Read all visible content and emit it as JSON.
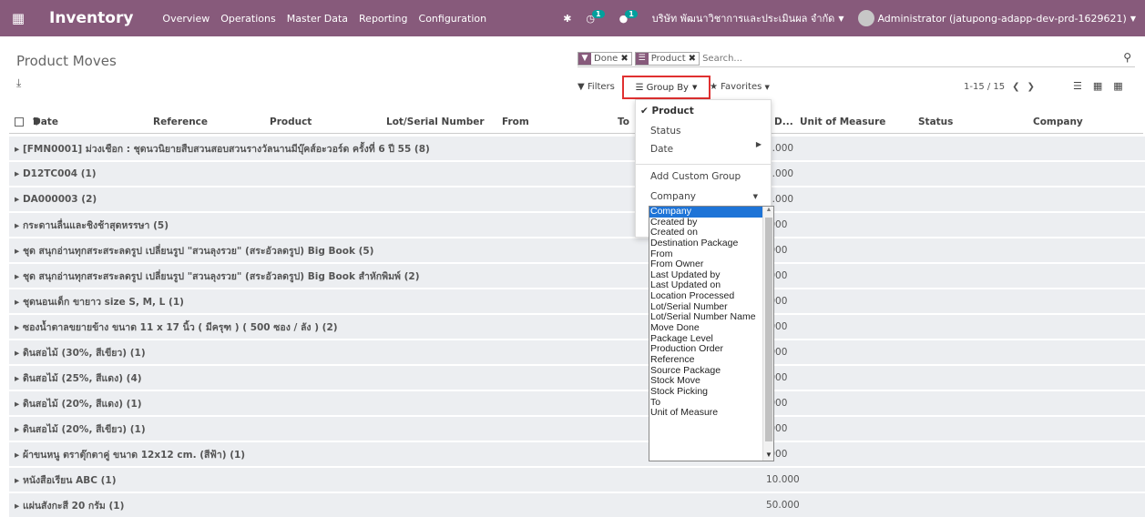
{
  "navbar": {
    "app_name": "Inventory",
    "menu": [
      "Overview",
      "Operations",
      "Master Data",
      "Reporting",
      "Configuration"
    ],
    "activity_badge": "1",
    "messaging_badge": "1",
    "company": "บริษัท พัฒนาวิชาการและประเมินผล จำกัด",
    "user": "Administrator (jatupong-adapp-dev-prd-1629621)"
  },
  "page": {
    "title": "Product Moves"
  },
  "search": {
    "facets": [
      {
        "label": "Done",
        "icon": "filter-icon"
      },
      {
        "label": "Product",
        "icon": "group-icon"
      }
    ],
    "placeholder": "Search..."
  },
  "toolbar": {
    "filters": "Filters",
    "group_by": "Group By",
    "favorites": "Favorites",
    "pager": "1-15 / 15"
  },
  "table": {
    "columns": [
      "Date",
      "Reference",
      "Product",
      "Lot/Serial Number",
      "From",
      "To",
      "D...",
      "Unit of Measure",
      "Status",
      "Company"
    ],
    "groups": [
      {
        "label": "[FMN0001] ม่วงเชือก : ชุดนวนิยายสืบสวนสอบสวนรางวัลนานมีบุ๊คส์อะวอร์ด ครั้งที่ 6 ปี 55 (8)",
        "value": "2.000"
      },
      {
        "label": "D12TC004 (1)",
        "value": "0.000"
      },
      {
        "label": "DA000003 (2)",
        "value": "1.000"
      },
      {
        "label": "กระดานลื่นและชิงช้าสุดหรรษา (5)",
        "value": ".000"
      },
      {
        "label": "ชุด สนุกอ่านทุกสระสระลดรูป เปลี่ยนรูป \"สวนลุงรวย\" (สระอัวลดรูป) Big Book (5)",
        "value": ".000"
      },
      {
        "label": "ชุด สนุกอ่านทุกสระสระลดรูป เปลี่ยนรูป \"สวนลุงรวย\" (สระอัวลดรูป) Big Book สำหักพิมพ์ (2)",
        "value": ".000"
      },
      {
        "label": "ชุดนอนเด็ก ขายาว size S, M, L (1)",
        "value": ".000"
      },
      {
        "label": "ซองน้ำตาลขยายข้าง ขนาด 11 x 17 นิ้ว ( มีครุฑ ) ( 500 ซอง / ลัง ) (2)",
        "value": ".000"
      },
      {
        "label": "ดินสอไม้ (30%, สีเขียว) (1)",
        "value": ".000"
      },
      {
        "label": "ดินสอไม้ (25%, สีแดง) (4)",
        "value": ".000"
      },
      {
        "label": "ดินสอไม้ (20%, สีแดง) (1)",
        "value": ".000"
      },
      {
        "label": "ดินสอไม้ (20%, สีเขียว) (1)",
        "value": ".000"
      },
      {
        "label": "ผ้าขนหนู ตราตุ๊กตาคู่ ขนาด 12x12 cm. (สีฟ้า) (1)",
        "value": ".000"
      },
      {
        "label": "หนังสือเรียน ABC (1)",
        "value": "10.000"
      },
      {
        "label": "แผ่นสังกะสี 20 กรัม (1)",
        "value": "50.000"
      }
    ]
  },
  "groupby_menu": {
    "checked_item": "Product",
    "items": [
      "Status",
      "Date"
    ],
    "add_custom": "Add Custom Group",
    "custom_select": "Company",
    "options": [
      "Company",
      "Created by",
      "Created on",
      "Destination Package",
      "From",
      "From Owner",
      "Last Updated by",
      "Last Updated on",
      "Location Processed",
      "Lot/Serial Number",
      "Lot/Serial Number Name",
      "Move Done",
      "Package Level",
      "Production Order",
      "Reference",
      "Source Package",
      "Stock Move",
      "Stock Picking",
      "To",
      "Unit of Measure"
    ],
    "selected_option": "Company"
  },
  "colors": {
    "brand": "#875a7b",
    "badge": "#00a09d",
    "highlight": "#e03030",
    "selection": "#1e74d7"
  }
}
